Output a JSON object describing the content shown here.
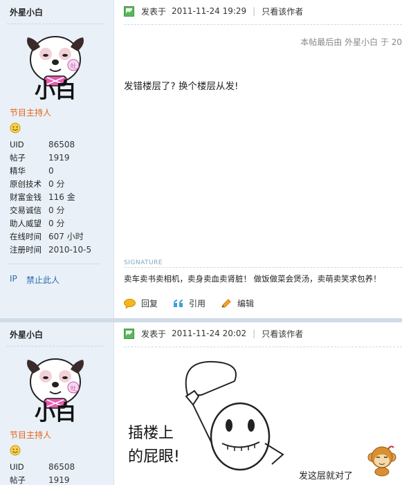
{
  "posts": [
    {
      "author": "外星小白",
      "avatar_text": "小白",
      "avatar_badge": "吐",
      "role": "节目主持人",
      "stats": [
        {
          "k": "UID",
          "v": "86508"
        },
        {
          "k": "帖子",
          "v": "1919"
        },
        {
          "k": "精华",
          "v": "0"
        },
        {
          "k": "原创技术",
          "v": "0 分"
        },
        {
          "k": "财富金钱",
          "v": "116 金"
        },
        {
          "k": "交易诚信",
          "v": "0 分"
        },
        {
          "k": "助人威望",
          "v": "0 分"
        },
        {
          "k": "在线时间",
          "v": "607 小时"
        },
        {
          "k": "注册时间",
          "v": "2010-10-5"
        }
      ],
      "ip_label": "IP",
      "ban_label": "禁止此人",
      "posted_label": "发表于",
      "time": "2011-11-24 19:29",
      "pipe": "|",
      "only_author": "只看该作者",
      "last_edit": "本帖最后由 外星小白 于 20",
      "content": "发错楼层了? 换个楼层从发!",
      "signature_label": "SIGNATURE",
      "signature": "卖车卖书卖相机，卖身卖血卖肾脏！  做饭做菜会煲汤，卖萌卖笑求包养！",
      "actions": {
        "reply": "回复",
        "quote": "引用",
        "edit": "编辑"
      }
    },
    {
      "author": "外星小白",
      "avatar_text": "小白",
      "avatar_badge": "吐",
      "role": "节目主持人",
      "stats": [
        {
          "k": "UID",
          "v": "86508"
        },
        {
          "k": "帖子",
          "v": "1919"
        }
      ],
      "posted_label": "发表于",
      "time": "2011-11-24 20:02",
      "pipe": "|",
      "only_author": "只看该作者",
      "comic_text": [
        "插楼上",
        "的屁眼!"
      ],
      "caption": "发这层就对了"
    }
  ],
  "colors": {
    "sidebar_bg": "#e9f0f7",
    "role": "#e6631b",
    "link": "#2b6cb0",
    "signature_label": "#7aa7c8",
    "post_icon": "#5bb85d"
  },
  "icons": {
    "post": "post-icon",
    "smiley": "smiley-icon",
    "reply": "reply-icon",
    "quote": "quote-icon",
    "edit": "edit-icon"
  }
}
